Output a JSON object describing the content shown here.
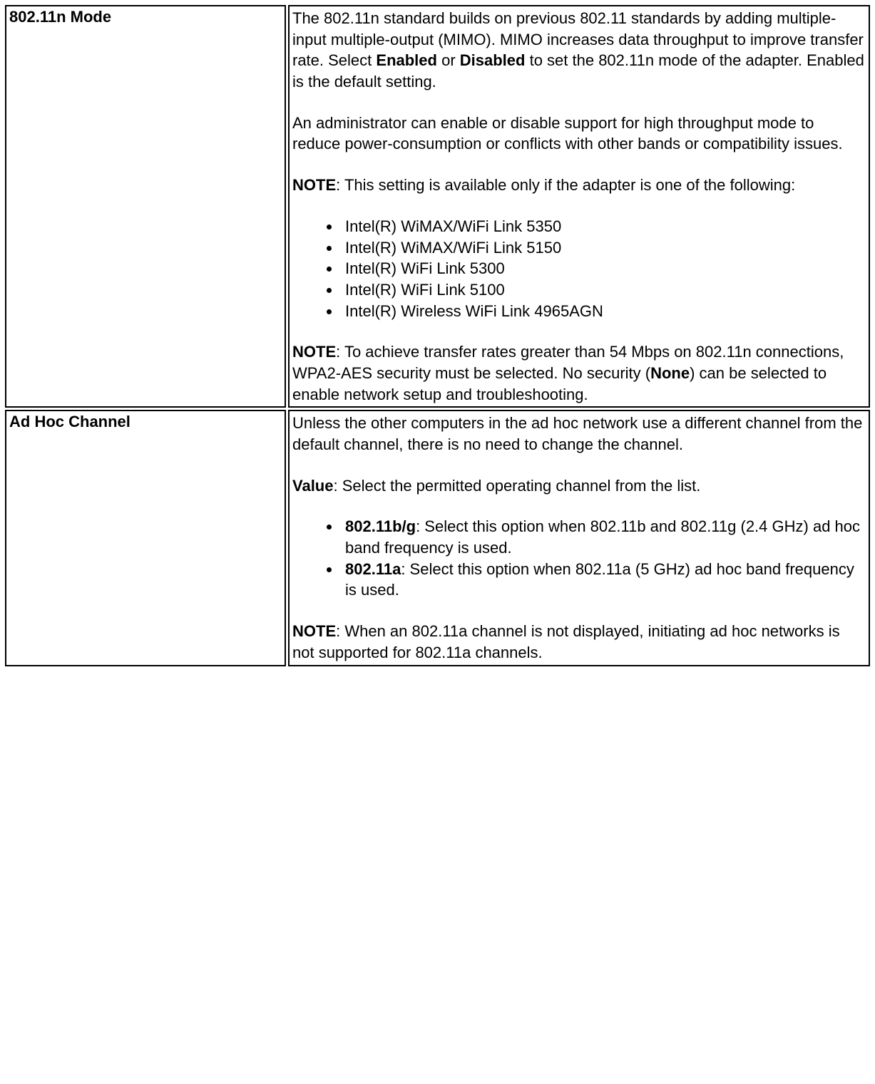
{
  "rows": [
    {
      "label": "802.11n Mode",
      "p1_a": "The 802.11n standard builds on previous 802.11 standards by adding multiple-input multiple-output (MIMO). MIMO increases data throughput to improve transfer rate. Select ",
      "p1_b1": "Enabled",
      "p1_mid": " or ",
      "p1_b2": "Disabled",
      "p1_c": " to set the 802.11n mode of the adapter. Enabled is the default setting.",
      "p2": "An administrator can enable or disable support for high throughput mode to reduce power-consumption or conflicts with other bands or compatibility issues.",
      "p3_label": "NOTE",
      "p3_rest": ": This setting is available only if the adapter is one of the following:",
      "list": [
        "Intel(R) WiMAX/WiFi Link 5350",
        "Intel(R) WiMAX/WiFi Link 5150",
        "Intel(R) WiFi Link 5300",
        "Intel(R) WiFi Link 5100",
        "Intel(R) Wireless WiFi Link 4965AGN"
      ],
      "p4_label": "NOTE",
      "p4_a": ": To achieve transfer rates greater than 54 Mbps on 802.11n connections, WPA2-AES security must be selected. No security (",
      "p4_b": "None",
      "p4_c": ") can be selected to enable network setup and troubleshooting."
    },
    {
      "label": "Ad Hoc Channel",
      "p1": "Unless the other computers in the ad hoc network use a different channel from the default channel, there is no need to change the channel.",
      "p2_label": "Value",
      "p2_rest": ": Select the permitted operating channel from the list.",
      "opt1_label": "802.11b/g",
      "opt1_rest": ": Select this option when 802.11b and 802.11g (2.4 GHz) ad hoc band frequency is used.",
      "opt2_label": "802.11a",
      "opt2_rest": ": Select this option when 802.11a (5 GHz) ad hoc band frequency is used.",
      "p3_label": "NOTE",
      "p3_rest": ": When an 802.11a channel is not displayed, initiating ad hoc networks is not supported for 802.11a channels."
    }
  ]
}
